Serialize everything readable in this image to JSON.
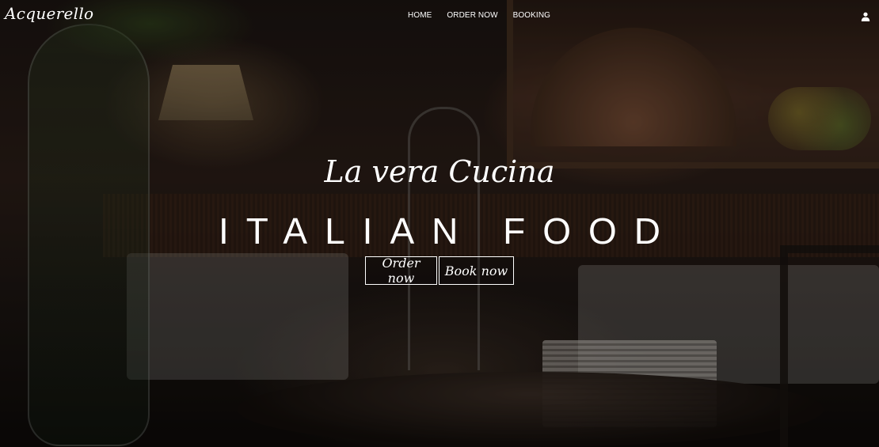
{
  "brand": {
    "logo": "Acquerello"
  },
  "nav": {
    "items": [
      {
        "label": "HOME"
      },
      {
        "label": "ORDER NOW"
      },
      {
        "label": "BOOKING"
      }
    ],
    "account_icon": "user-icon"
  },
  "hero": {
    "tagline": "La vera Cucina",
    "headline": "ITALIAN FOOD",
    "buttons": {
      "order": "Order now",
      "book": "Book now"
    },
    "background_image": "dim restaurant interior with dessert stand"
  },
  "colors": {
    "text": "#ffffff",
    "background": "#1b1411"
  }
}
